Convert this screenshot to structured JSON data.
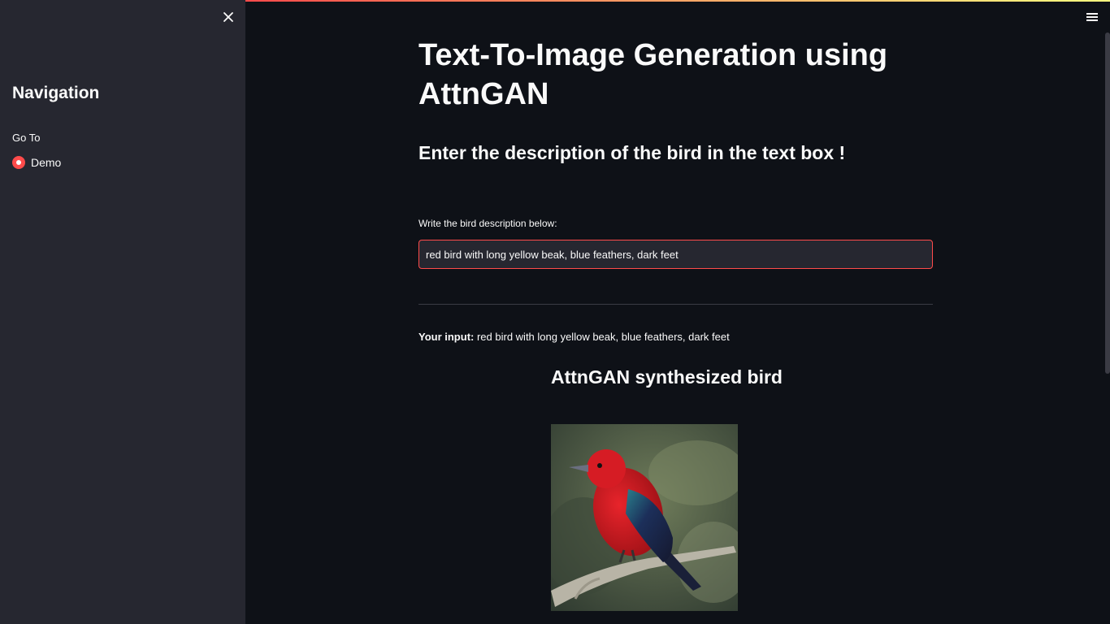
{
  "sidebar": {
    "title": "Navigation",
    "radio_label": "Go To",
    "options": [
      {
        "label": "Demo",
        "selected": true
      }
    ]
  },
  "header": {
    "menu_icon": "hamburger-icon",
    "close_icon": "close-icon"
  },
  "main": {
    "title": "Text-To-Image Generation using AttnGAN",
    "subtitle": "Enter the description of the bird in the text box !",
    "input_label": "Write the bird description below:",
    "input_value": "red bird with long yellow beak, blue feathers, dark feet",
    "your_input_prefix": "Your input:",
    "your_input_text": " red bird with long yellow beak, blue feathers, dark feet",
    "result_heading": "AttnGAN synthesized bird",
    "image_alt": "synthesized bird image"
  },
  "colors": {
    "background": "#0e1117",
    "sidebar": "#262730",
    "accent": "#ff4b4b"
  }
}
